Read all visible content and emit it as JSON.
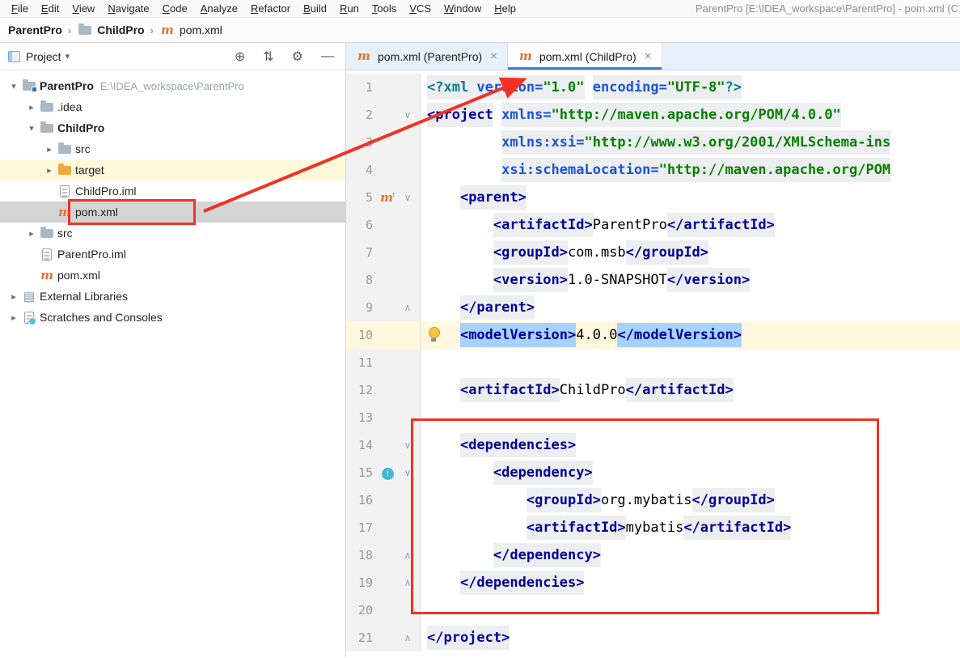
{
  "window": {
    "title": "ParentPro [E:\\IDEA_workspace\\ParentPro] - pom.xml (C"
  },
  "menu": {
    "items": [
      "File",
      "Edit",
      "View",
      "Navigate",
      "Code",
      "Analyze",
      "Refactor",
      "Build",
      "Run",
      "Tools",
      "VCS",
      "Window",
      "Help"
    ]
  },
  "breadcrumb": {
    "items": [
      {
        "label": "ParentPro",
        "bold": true,
        "icon": null
      },
      {
        "label": "ChildPro",
        "bold": true,
        "icon": "folder"
      },
      {
        "label": "pom.xml",
        "bold": false,
        "icon": "maven-file"
      }
    ]
  },
  "project_panel": {
    "title": "Project",
    "caret": "▾",
    "header_icons": [
      {
        "name": "locate-icon",
        "glyph": "⊕"
      },
      {
        "name": "collapse-all-icon",
        "glyph": "⇅"
      },
      {
        "name": "settings-gear-icon",
        "glyph": "⚙"
      },
      {
        "name": "hide-panel-icon",
        "glyph": "—"
      }
    ],
    "tree": [
      {
        "label": "ParentPro",
        "path": "E:\\IDEA_workspace\\ParentPro",
        "indent": 0,
        "chevron": "down",
        "icon": "maven-project",
        "bold": true
      },
      {
        "label": ".idea",
        "indent": 1,
        "chevron": "right",
        "icon": "folder"
      },
      {
        "label": "ChildPro",
        "indent": 1,
        "chevron": "down",
        "icon": "folder",
        "bold": true
      },
      {
        "label": "src",
        "indent": 2,
        "chevron": "right",
        "icon": "folder"
      },
      {
        "label": "target",
        "indent": 2,
        "chevron": "right",
        "icon": "folder-excluded",
        "highlight": true
      },
      {
        "label": "ChildPro.iml",
        "indent": 2,
        "icon": "iml-file"
      },
      {
        "label": "pom.xml",
        "indent": 2,
        "icon": "maven-file",
        "selected": true
      },
      {
        "label": "src",
        "indent": 1,
        "chevron": "right",
        "icon": "folder"
      },
      {
        "label": "ParentPro.iml",
        "indent": 1,
        "icon": "iml-file"
      },
      {
        "label": "pom.xml",
        "indent": 1,
        "icon": "maven-file"
      },
      {
        "label": "External Libraries",
        "indent": 0,
        "chevron": "right",
        "icon": "libraries"
      },
      {
        "label": "Scratches and Consoles",
        "indent": 0,
        "chevron": "right",
        "icon": "scratches"
      }
    ]
  },
  "tabs": [
    {
      "label": "pom.xml (ParentPro)",
      "active": false
    },
    {
      "label": "pom.xml (ChildPro)",
      "active": true
    }
  ],
  "editor": {
    "lines": [
      {
        "n": 1,
        "tokens": [
          [
            "pi",
            "<?xml "
          ],
          [
            "attr",
            "version="
          ],
          [
            "str",
            "\"1.0\""
          ],
          [
            "plain",
            " "
          ],
          [
            "attr",
            "encoding="
          ],
          [
            "str",
            "\"UTF-8\""
          ],
          [
            "pi",
            "?>"
          ]
        ]
      },
      {
        "n": 2,
        "fold": "start",
        "tokens": [
          [
            "tag",
            "<project"
          ],
          [
            "plain",
            " "
          ],
          [
            "attr",
            "xmlns="
          ],
          [
            "str",
            "\"http://maven.apache.org/POM/4.0.0\""
          ]
        ]
      },
      {
        "n": 3,
        "tokens": [
          [
            "plain",
            "         "
          ],
          [
            "attr",
            "xmlns:xsi="
          ],
          [
            "str",
            "\"http://www.w3.org/2001/XMLSchema-ins"
          ]
        ]
      },
      {
        "n": 4,
        "tokens": [
          [
            "plain",
            "         "
          ],
          [
            "attr",
            "xsi:schemaLocation="
          ],
          [
            "str",
            "\"http://maven.apache.org/POM"
          ]
        ]
      },
      {
        "n": 5,
        "fold": "start",
        "icon": "maven-up",
        "tokens": [
          [
            "plain",
            "    "
          ],
          [
            "tag",
            "<parent>"
          ]
        ]
      },
      {
        "n": 6,
        "tokens": [
          [
            "plain",
            "        "
          ],
          [
            "tag",
            "<artifactId>"
          ],
          [
            "plain",
            "ParentPro"
          ],
          [
            "tag",
            "</artifactId>"
          ]
        ]
      },
      {
        "n": 7,
        "tokens": [
          [
            "plain",
            "        "
          ],
          [
            "tag",
            "<groupId>"
          ],
          [
            "plain",
            "com.msb"
          ],
          [
            "tag",
            "</groupId>"
          ]
        ]
      },
      {
        "n": 8,
        "tokens": [
          [
            "plain",
            "        "
          ],
          [
            "tag",
            "<version>"
          ],
          [
            "plain",
            "1.0-SNAPSHOT"
          ],
          [
            "tag",
            "</version>"
          ]
        ]
      },
      {
        "n": 9,
        "fold": "end",
        "tokens": [
          [
            "plain",
            "    "
          ],
          [
            "tag",
            "</parent>"
          ]
        ]
      },
      {
        "n": 10,
        "current": true,
        "bulb": true,
        "tokens": [
          [
            "plain",
            "    "
          ],
          [
            "taghl",
            "<modelVersion>"
          ],
          [
            "plain",
            "4.0.0"
          ],
          [
            "taghl",
            "</modelVersion>"
          ]
        ]
      },
      {
        "n": 11,
        "tokens": []
      },
      {
        "n": 12,
        "tokens": [
          [
            "plain",
            "    "
          ],
          [
            "tag",
            "<artifactId>"
          ],
          [
            "plain",
            "ChildPro"
          ],
          [
            "tag",
            "</artifactId>"
          ]
        ]
      },
      {
        "n": 13,
        "tokens": []
      },
      {
        "n": 14,
        "fold": "start",
        "tokens": [
          [
            "plain",
            "    "
          ],
          [
            "tag",
            "<dependencies>"
          ]
        ]
      },
      {
        "n": 15,
        "fold": "start",
        "icon": "override",
        "tokens": [
          [
            "plain",
            "        "
          ],
          [
            "tag",
            "<dependency>"
          ]
        ]
      },
      {
        "n": 16,
        "tokens": [
          [
            "plain",
            "            "
          ],
          [
            "tag",
            "<groupId>"
          ],
          [
            "plain",
            "org.mybatis"
          ],
          [
            "tag",
            "</groupId>"
          ]
        ]
      },
      {
        "n": 17,
        "tokens": [
          [
            "plain",
            "            "
          ],
          [
            "tag",
            "<artifactId>"
          ],
          [
            "plain",
            "mybatis"
          ],
          [
            "tag",
            "</artifactId>"
          ]
        ]
      },
      {
        "n": 18,
        "fold": "end",
        "tokens": [
          [
            "plain",
            "        "
          ],
          [
            "tag",
            "</dependency>"
          ]
        ]
      },
      {
        "n": 19,
        "fold": "end",
        "tokens": [
          [
            "plain",
            "    "
          ],
          [
            "tag",
            "</dependencies>"
          ]
        ]
      },
      {
        "n": 20,
        "tokens": []
      },
      {
        "n": 21,
        "fold": "end",
        "tokens": [
          [
            "tag",
            "</project>"
          ]
        ]
      }
    ]
  },
  "icons": {
    "maven_glyph": "m",
    "chevron_down": "▾",
    "chevron_right": "▸",
    "fold_open": "∨",
    "fold_close": "∧",
    "close_glyph": "×",
    "crumb_sep": "›",
    "libraries_glyph": "▤",
    "override_glyph": "↑",
    "maven_up_arrow": "↑"
  },
  "colors": {
    "annotation_red": "#F23222",
    "selection_blue": "#A6D2FF",
    "current_line_yellow": "#FFF8DE",
    "excluded_yellow": "#FFF9DB",
    "tab_underline_blue": "#3C7FD0",
    "tag_navy": "#000099",
    "attr_blue": "#1A54D9",
    "string_green": "#068000",
    "pi_teal": "#0A7E8C"
  }
}
